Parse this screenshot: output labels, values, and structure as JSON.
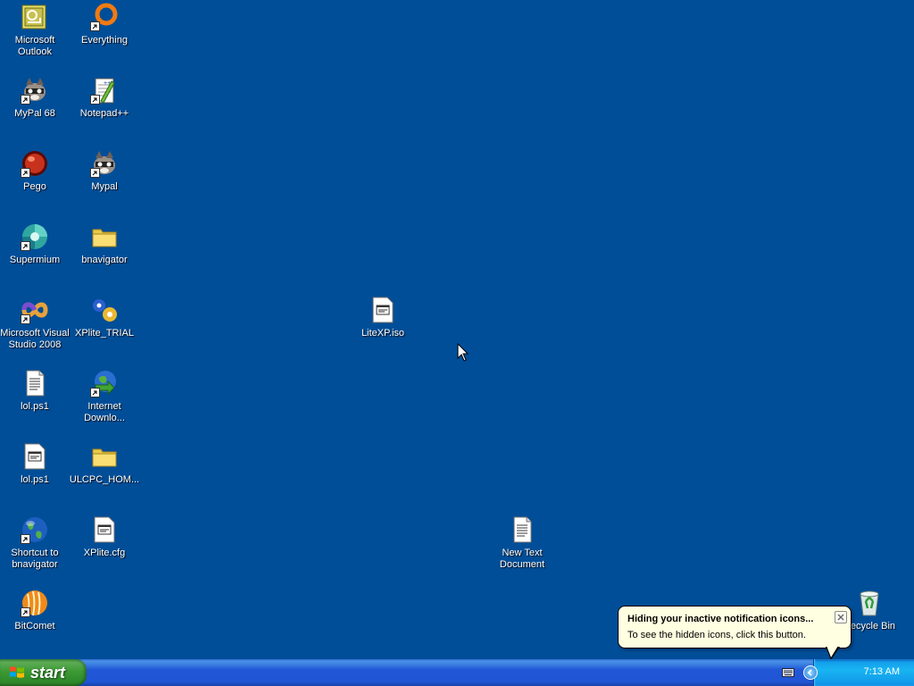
{
  "desktop_icons": [
    {
      "label": "Microsoft Outlook",
      "icon": "outlook-icon"
    },
    {
      "label": "Everything",
      "icon": "everything-icon"
    },
    {
      "label": "MyPal 68",
      "icon": "mypal-icon"
    },
    {
      "label": "Notepad++",
      "icon": "notepadpp-icon"
    },
    {
      "label": "Pego",
      "icon": "pego-icon"
    },
    {
      "label": "Mypal",
      "icon": "mypal-icon"
    },
    {
      "label": "Supermium",
      "icon": "supermium-icon"
    },
    {
      "label": "bnavigator",
      "icon": "folder-icon"
    },
    {
      "label": "Microsoft Visual Studio 2008",
      "icon": "visual-studio-icon"
    },
    {
      "label": "XPlite_TRIAL",
      "icon": "xplite-icon"
    },
    {
      "label": "lol.ps1",
      "icon": "text-file-icon"
    },
    {
      "label": "Internet Downlo...",
      "icon": "internet-download-manager-icon"
    },
    {
      "label": "lol.ps1",
      "icon": "generic-file-icon"
    },
    {
      "label": "ULCPC_HOM...",
      "icon": "folder-icon"
    },
    {
      "label": "Shortcut to bnavigator",
      "icon": "globe-icon"
    },
    {
      "label": "XPlite.cfg",
      "icon": "generic-file-icon"
    },
    {
      "label": "BitComet",
      "icon": "bitcomet-icon"
    },
    {
      "label": "LiteXP.iso",
      "icon": "generic-file-icon"
    },
    {
      "label": "New Text Document",
      "icon": "text-file-icon"
    },
    {
      "label": "Recycle Bin",
      "icon": "recycle-bin-icon"
    }
  ],
  "taskbar": {
    "start_label": "start",
    "clock": "7:13 AM"
  },
  "balloon": {
    "title": "Hiding your inactive notification icons...",
    "body": "To see the hidden icons, click this button."
  },
  "colors": {
    "desktop": "#004e98",
    "taskbar": "#2157d7",
    "start": "#3c9a35",
    "tray": "#18b5f2",
    "balloon": "#ffffe1"
  }
}
